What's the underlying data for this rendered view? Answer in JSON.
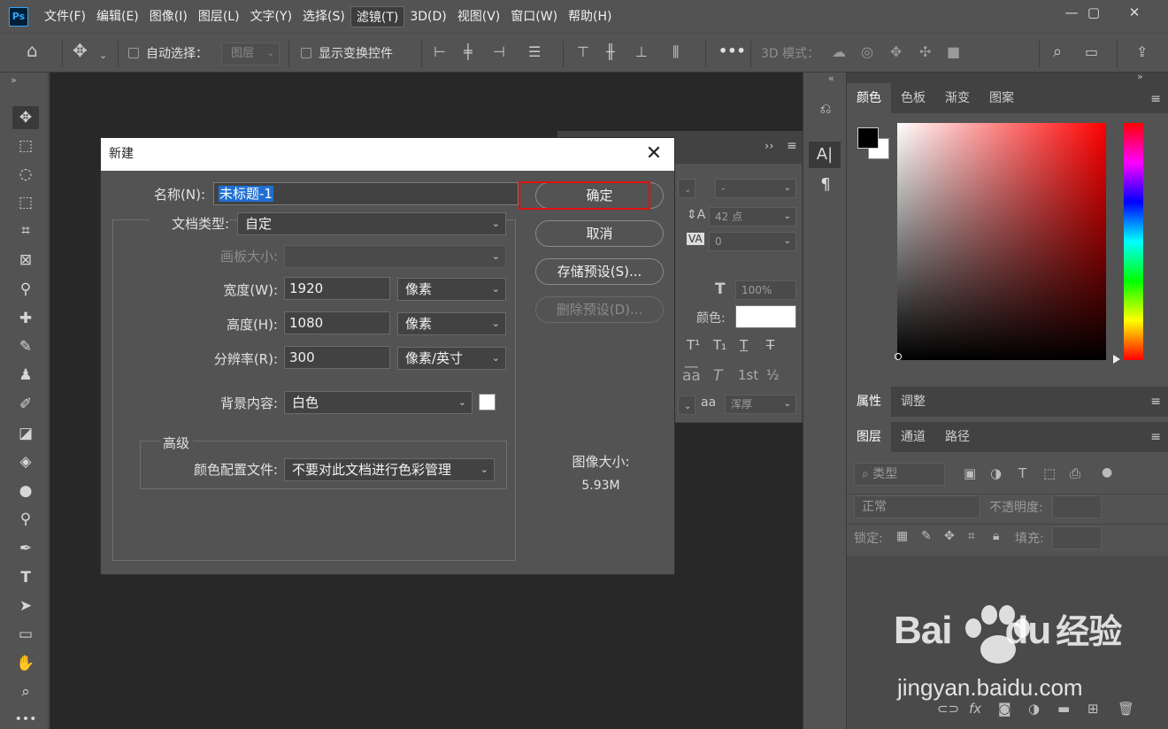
{
  "app": {
    "logo": "Ps"
  },
  "menu": [
    "文件(F)",
    "编辑(E)",
    "图像(I)",
    "图层(L)",
    "文字(Y)",
    "选择(S)",
    "滤镜(T)",
    "3D(D)",
    "视图(V)",
    "窗口(W)",
    "帮助(H)"
  ],
  "window_controls": {
    "minimize": "—",
    "maximize": "▢",
    "close": "✕"
  },
  "options": {
    "auto_select_label": "自动选择：",
    "auto_select_value": "图层",
    "show_transform_label": "显示变换控件",
    "more": "•••",
    "mode_3d_label": "3D 模式："
  },
  "char_panel": {
    "header_icons": "››",
    "font_size": "42 点",
    "tracking": "0",
    "dash": "-",
    "scale": "100%",
    "color_label": "颜色:",
    "antialias": "浑厚",
    "aa_label": "aa"
  },
  "right": {
    "color_tabs": [
      "颜色",
      "色板",
      "渐变",
      "图案"
    ],
    "prop_tabs": [
      "属性",
      "调整"
    ],
    "layer_tabs": [
      "图层",
      "通道",
      "路径"
    ],
    "search_kind": "类型",
    "blend_mode": "正常",
    "opacity_label": "不透明度:",
    "lock_label": "锁定:",
    "fill_label": "填充:",
    "foreground_color": "#000000",
    "background_color": "#ffffff"
  },
  "dialog": {
    "title": "新建",
    "close": "✕",
    "name_label": "名称(N):",
    "name_value": "未标题-1",
    "doc_type_label": "文档类型:",
    "doc_type_value": "自定",
    "artboard_label": "画板大小:",
    "artboard_value": "",
    "width_label": "宽度(W):",
    "width_value": "1920",
    "width_unit": "像素",
    "height_label": "高度(H):",
    "height_value": "1080",
    "height_unit": "像素",
    "resolution_label": "分辨率(R):",
    "resolution_value": "300",
    "resolution_unit": "像素/英寸",
    "bg_label": "背景内容:",
    "bg_value": "白色",
    "advanced_title": "高级",
    "color_profile_label": "颜色配置文件:",
    "color_profile_value": "不要对此文档进行色彩管理",
    "ok": "确定",
    "cancel": "取消",
    "save_preset": "存储预设(S)...",
    "delete_preset": "删除预设(D)...",
    "image_size_label": "图像大小:",
    "image_size_value": "5.93M"
  },
  "watermark": {
    "brand_a": "Bai",
    "brand_b": "du",
    "brand_c": "经验",
    "url": "jingyan.baidu.com"
  }
}
